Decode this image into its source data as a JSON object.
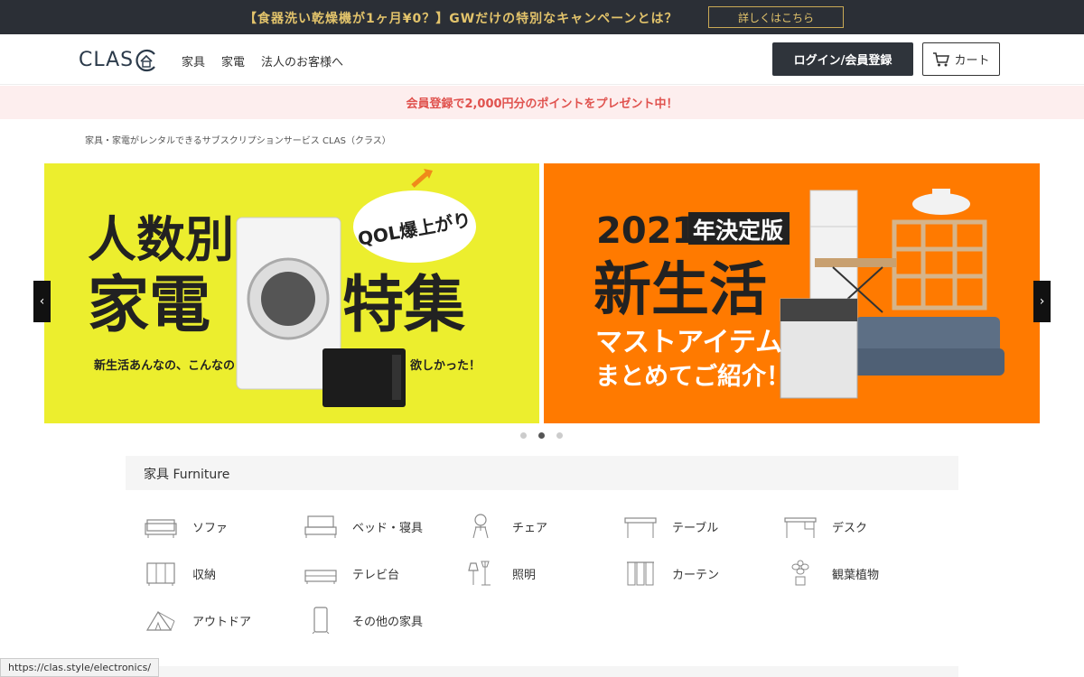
{
  "topbar": {
    "promo": "【食器洗い乾燥機が1ヶ月¥0？】GWだけの特別なキャンペーンとは？",
    "detail_label": "詳しくはこちら"
  },
  "header": {
    "logo": "CLAS",
    "nav": [
      "家具",
      "家電",
      "法人のお客様へ"
    ],
    "login_label": "ログイン/会員登録",
    "cart_label": "カート"
  },
  "pinkbar": {
    "text": "会員登録で2,000円分のポイントをプレゼント中！"
  },
  "breadcrumb": "家具・家電がレンタルできるサブスクリプションサービス CLAS（クラス）",
  "banners": {
    "left": {
      "line1": "人数別",
      "line2a": "家電",
      "line2b": "特集",
      "bubble": "QOL爆上がり",
      "sub_left": "新生活あんなの、こんなの",
      "sub_right": "欲しかった！"
    },
    "right": {
      "year": "2021",
      "year_suffix": "年決定版",
      "title": "新生活",
      "sub1": "マストアイテム",
      "sub2": "まとめてご紹介！"
    }
  },
  "carousel": {
    "prev": "‹",
    "next": "›",
    "dot_count": 3,
    "active_dot": 2
  },
  "furniture": {
    "heading": "家具 Furniture",
    "items": [
      {
        "label": "ソファ",
        "icon": "sofa-icon"
      },
      {
        "label": "ベッド・寝具",
        "icon": "bed-icon"
      },
      {
        "label": "チェア",
        "icon": "chair-icon"
      },
      {
        "label": "テーブル",
        "icon": "table-icon"
      },
      {
        "label": "デスク",
        "icon": "desk-icon"
      },
      {
        "label": "収納",
        "icon": "storage-icon"
      },
      {
        "label": "テレビ台",
        "icon": "tv-stand-icon"
      },
      {
        "label": "照明",
        "icon": "lamp-icon"
      },
      {
        "label": "カーテン",
        "icon": "curtain-icon"
      },
      {
        "label": "観葉植物",
        "icon": "plant-icon"
      },
      {
        "label": "アウトドア",
        "icon": "tent-icon"
      },
      {
        "label": "その他の家具",
        "icon": "mirror-icon"
      }
    ]
  },
  "statusbar": {
    "url": "https://clas.style/electronics/"
  },
  "colors": {
    "accent_dark": "#2f343b",
    "promo_gold": "#e2c36b",
    "pink_text": "#e0524e",
    "banner_yellow": "#ecee2e",
    "banner_orange": "#ff7a00"
  }
}
